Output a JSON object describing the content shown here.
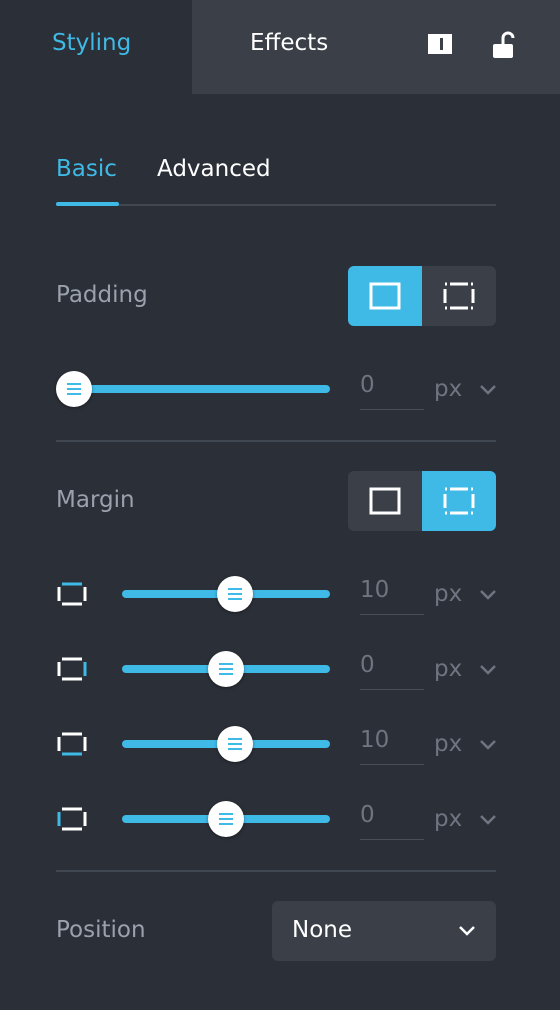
{
  "tabs": {
    "styling": "Styling",
    "effects": "Effects"
  },
  "subtabs": {
    "basic": "Basic",
    "advanced": "Advanced"
  },
  "padding": {
    "label": "Padding",
    "value": "0",
    "unit": "px",
    "slider_fraction": 0.0,
    "mode": "uniform"
  },
  "margin": {
    "label": "Margin",
    "mode": "individual",
    "rows": [
      {
        "side": "top",
        "value": "10",
        "unit": "px",
        "slider_fraction": 0.54
      },
      {
        "side": "right",
        "value": "0",
        "unit": "px",
        "slider_fraction": 0.5
      },
      {
        "side": "bottom",
        "value": "10",
        "unit": "px",
        "slider_fraction": 0.54
      },
      {
        "side": "left",
        "value": "0",
        "unit": "px",
        "slider_fraction": 0.5
      }
    ]
  },
  "position": {
    "label": "Position",
    "value": "None"
  },
  "colors": {
    "accent": "#3fb9e6",
    "background": "#2b2f37",
    "panel": "#3a3f48",
    "muted_text": "#9aa1ac"
  },
  "icons": [
    "panel-toggle-icon",
    "unlock-icon",
    "uniform-box-icon",
    "individual-sides-icon",
    "chevron-down-icon",
    "slider-grip-icon",
    "margin-top-icon",
    "margin-right-icon",
    "margin-bottom-icon",
    "margin-left-icon"
  ]
}
